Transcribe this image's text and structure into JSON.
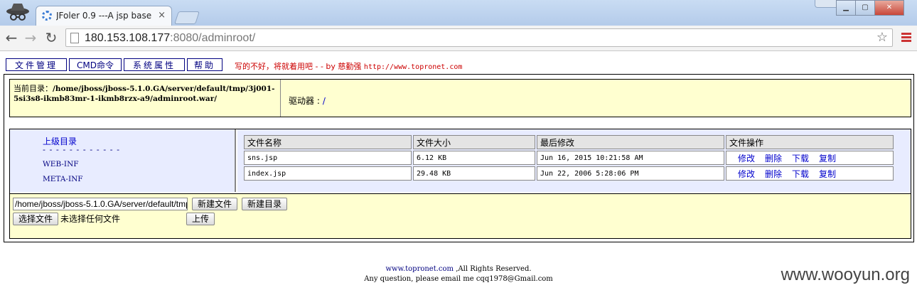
{
  "browser": {
    "tab_title": "JFoler 0.9 ---A jsp base",
    "tab_close": "×",
    "url_host": "180.153.108.177",
    "url_rest": ":8080/adminroot/",
    "icons": [
      "incognito-icon",
      "spinner-icon",
      "back-icon",
      "forward-icon",
      "reload-icon",
      "page-icon",
      "star-icon",
      "menu-icon"
    ]
  },
  "nav": {
    "items": [
      "文件管理",
      "CMD命令",
      "系统属性",
      "帮助"
    ],
    "credit": "写的不好，将就着用吧 - - by 慈勤强",
    "credit_url": "http://www.topronet.com"
  },
  "info": {
    "cwd_label": "当前目录：",
    "cwd_path": "/home/jboss/jboss-5.1.0.GA/server/default/tmp/3j001-5si3s8-ikmb83mr-1-ikmb8rzx-a9/adminroot.war/",
    "drive_label": "驱动器 :",
    "drive_value": "/"
  },
  "tree": {
    "up": "上级目录",
    "dashes": "- - - - - - - - - - - -",
    "dirs": [
      "WEB-INF",
      "META-INF"
    ]
  },
  "files": {
    "headers": [
      "文件名称",
      "文件大小",
      "最后修改",
      "文件操作"
    ],
    "ops": [
      "修改",
      "删除",
      "下载",
      "复制"
    ],
    "rows": [
      {
        "name": "sns.jsp",
        "size": "6.12 KB",
        "modified": "Jun 16, 2015 10:21:58 AM"
      },
      {
        "name": "index.jsp",
        "size": "29.48 KB",
        "modified": "Jun 22, 2006 5:28:06 PM"
      }
    ]
  },
  "actions": {
    "path_value": "/home/jboss/jboss-5.1.0.GA/server/default/tmp",
    "new_file": "新建文件",
    "new_dir": "新建目录",
    "choose_file": "选择文件",
    "no_file": "未选择任何文件",
    "upload": "上传"
  },
  "footer": {
    "site": "www.topronet.com",
    "rights": ",All Rights Reserved.",
    "line2": "Any question, please email me cqq1978@Gmail.com"
  },
  "watermark": "www.wooyun.org"
}
